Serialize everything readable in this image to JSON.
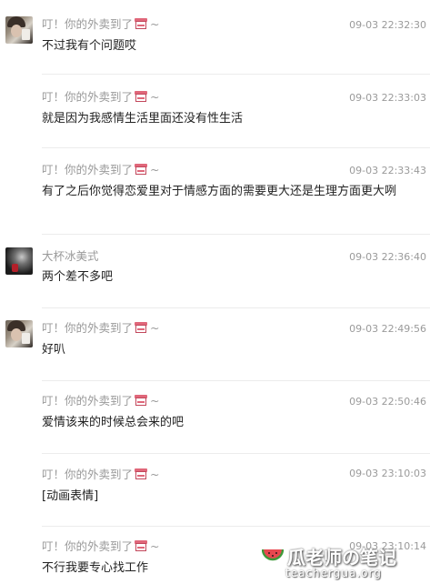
{
  "messages": [
    {
      "sender": "叮！你的外卖到了",
      "suffix": "~",
      "time": "09-03 22:32:30",
      "text": "不过我有个问题哎",
      "avatar": "girl-avatar"
    },
    {
      "sender": "叮！你的外卖到了",
      "suffix": "~",
      "time": "09-03 22:33:03",
      "text": "就是因为我感情生活里面还没有性生活",
      "avatar": "none"
    },
    {
      "sender": "叮！你的外卖到了",
      "suffix": "~",
      "time": "09-03 22:33:43",
      "text": "有了之后你觉得恋爱里对于情感方面的需要更大还是生理方面更大咧",
      "avatar": "none"
    },
    {
      "sender": "大杯冰美式",
      "suffix": "",
      "time": "09-03 22:36:40",
      "text": "两个差不多吧",
      "avatar": "dark-avatar"
    },
    {
      "sender": "叮！你的外卖到了",
      "suffix": "~",
      "time": "09-03 22:49:56",
      "text": "好叭",
      "avatar": "girl-avatar"
    },
    {
      "sender": "叮！你的外卖到了",
      "suffix": "~",
      "time": "09-03 22:50:46",
      "text": "爱情该来的时候总会来的吧",
      "avatar": "none"
    },
    {
      "sender": "叮！你的外卖到了",
      "suffix": "~",
      "time": "09-03 23:10:03",
      "text": "[动画表情]",
      "avatar": "none"
    },
    {
      "sender": "叮！你的外卖到了",
      "suffix": "~",
      "time": "09-03 23:10:14",
      "text": "不行我要专心找工作",
      "avatar": "none"
    }
  ],
  "watermark": {
    "title": "瓜老师の笔记",
    "url": "teachergua.org"
  }
}
